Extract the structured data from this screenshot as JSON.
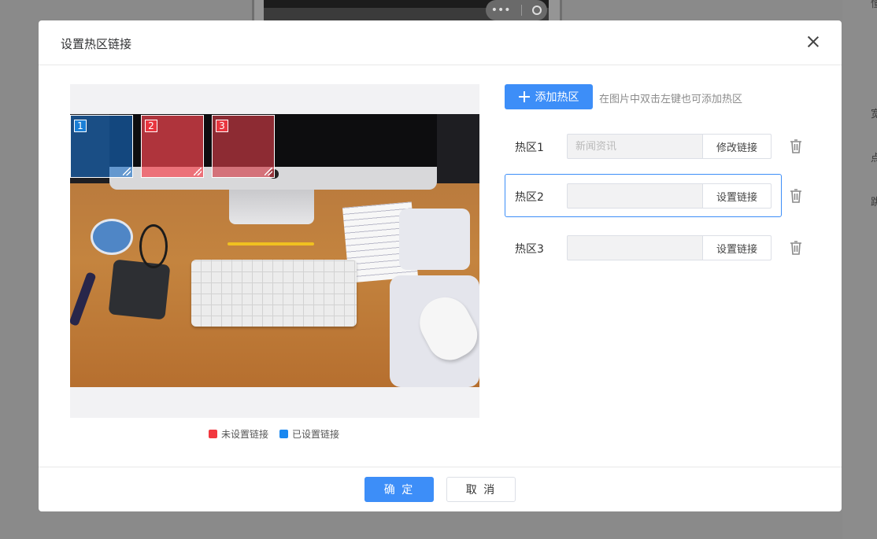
{
  "background": {
    "capsule_dots": "•••",
    "right_panel_fragments": [
      "懂",
      "宽",
      "点",
      "跳"
    ]
  },
  "modal": {
    "title": "设置热区链接",
    "add_button_label": "添加热区",
    "add_hint": "在图片中双击左键也可添加热区",
    "legend": [
      {
        "label": "未设置链接",
        "color": "#f2383f"
      },
      {
        "label": "已设置链接",
        "color": "#1a88f0"
      }
    ],
    "hotspots": [
      {
        "number": "1",
        "state": "blue"
      },
      {
        "number": "2",
        "state": "red"
      },
      {
        "number": "3",
        "state": "red"
      }
    ],
    "rows": [
      {
        "label": "热区1",
        "value": "",
        "placeholder": "新闻资讯",
        "button": "修改链接",
        "active": false
      },
      {
        "label": "热区2",
        "value": "",
        "placeholder": "",
        "button": "设置链接",
        "active": true
      },
      {
        "label": "热区3",
        "value": "",
        "placeholder": "",
        "button": "设置链接",
        "active": false
      }
    ],
    "ok_label": "确 定",
    "cancel_label": "取 消"
  },
  "colors": {
    "primary": "#3d8ef8",
    "unset": "#f2383f",
    "set": "#1a88f0"
  }
}
